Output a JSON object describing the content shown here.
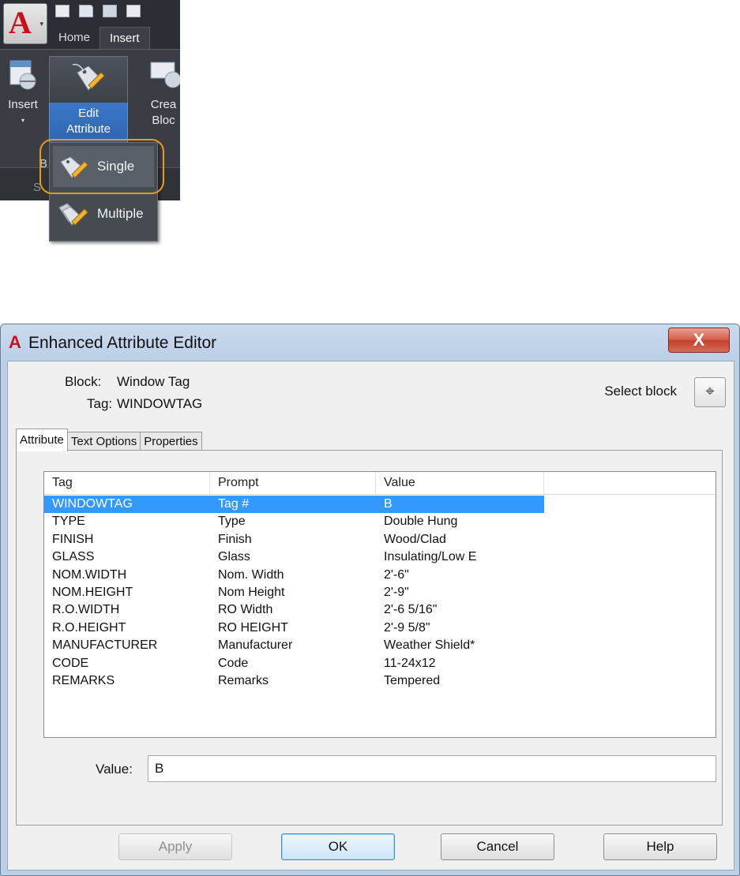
{
  "ribbon": {
    "app_button": {
      "letter": "A",
      "icon": "autocad-logo-icon"
    },
    "quick_access": [
      "new-icon",
      "open-icon",
      "save-icon",
      "saveas-icon"
    ],
    "tabs": [
      {
        "label": "Home"
      },
      {
        "label": "Insert",
        "active": true
      }
    ],
    "buttons": {
      "insert": {
        "label": "Insert"
      },
      "edit_attribute": {
        "label_line1": "Edit",
        "label_line2": "Attribute"
      },
      "create_block": {
        "label_line1": "Crea",
        "label_line2": "Bloc"
      }
    },
    "panel_title_fragment": "B",
    "panel_tab_fragment": "S",
    "dropdown": {
      "items": [
        {
          "label": "Single",
          "highlighted": true,
          "icon": "edit-attribute-single-icon"
        },
        {
          "label": "Multiple",
          "icon": "edit-attribute-multiple-icon"
        }
      ],
      "highlight_color": "#e89a1a"
    }
  },
  "dialog": {
    "title": "Enhanced Attribute Editor",
    "close_glyph": "X",
    "block_label": "Block:",
    "block_value": "Window Tag",
    "tag_label": "Tag:",
    "tag_value": "WINDOWTAG",
    "select_block_label": "Select block",
    "tabs": [
      {
        "label": "Attribute",
        "active": true
      },
      {
        "label": "Text Options"
      },
      {
        "label": "Properties"
      }
    ],
    "table": {
      "columns": [
        "Tag",
        "Prompt",
        "Value"
      ],
      "rows": [
        {
          "tag": "WINDOWTAG",
          "prompt": "Tag #",
          "value": "B",
          "selected": true
        },
        {
          "tag": "TYPE",
          "prompt": "Type",
          "value": "Double Hung"
        },
        {
          "tag": "FINISH",
          "prompt": "Finish",
          "value": "Wood/Clad"
        },
        {
          "tag": "GLASS",
          "prompt": "Glass",
          "value": "Insulating/Low E"
        },
        {
          "tag": "NOM.WIDTH",
          "prompt": "Nom. Width",
          "value": "2'-6\""
        },
        {
          "tag": "NOM.HEIGHT",
          "prompt": "Nom Height",
          "value": "2'-9\""
        },
        {
          "tag": "R.O.WIDTH",
          "prompt": "RO Width",
          "value": "2'-6 5/16\""
        },
        {
          "tag": "R.O.HEIGHT",
          "prompt": "RO HEIGHT",
          "value": "2'-9 5/8\""
        },
        {
          "tag": "MANUFACTURER",
          "prompt": "Manufacturer",
          "value": "Weather Shield*"
        },
        {
          "tag": "CODE",
          "prompt": "Code",
          "value": "11-24x12"
        },
        {
          "tag": "REMARKS",
          "prompt": "Remarks",
          "value": "Tempered"
        }
      ],
      "selected_color": "#3399ff"
    },
    "value_label": "Value:",
    "value_input": "B",
    "buttons": {
      "apply": {
        "label": "Apply",
        "enabled": false
      },
      "ok": {
        "label": "OK",
        "default": true
      },
      "cancel": {
        "label": "Cancel"
      },
      "help": {
        "label": "Help"
      }
    }
  }
}
